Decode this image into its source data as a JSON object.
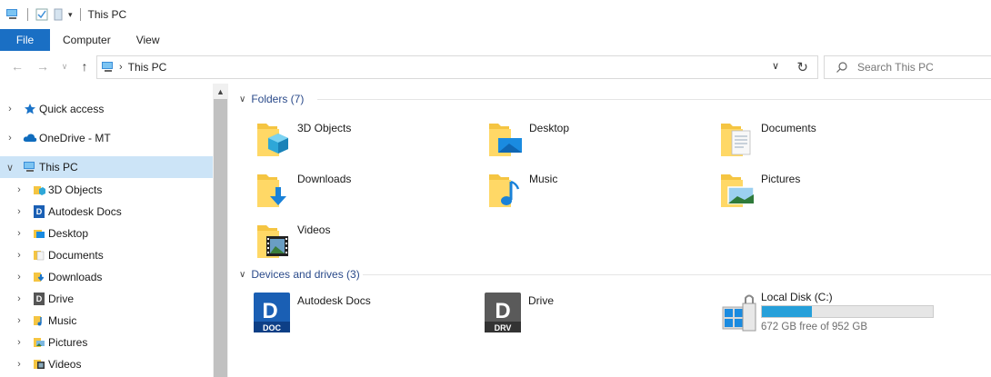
{
  "window": {
    "title": "This PC"
  },
  "ribbon": {
    "tabs": [
      "File",
      "Computer",
      "View"
    ]
  },
  "address": {
    "location": "This PC"
  },
  "search": {
    "placeholder": "Search This PC"
  },
  "sidebar": {
    "items": [
      {
        "label": "Quick access",
        "icon": "star-icon"
      },
      {
        "label": "OneDrive - MT",
        "icon": "cloud-icon"
      },
      {
        "label": "This PC",
        "icon": "computer-icon",
        "expanded": true,
        "selected": true
      },
      {
        "label": "3D Objects",
        "icon": "3d-objects-icon"
      },
      {
        "label": "Autodesk Docs",
        "icon": "autodesk-docs-icon"
      },
      {
        "label": "Desktop",
        "icon": "desktop-folder-icon"
      },
      {
        "label": "Documents",
        "icon": "documents-folder-icon"
      },
      {
        "label": "Downloads",
        "icon": "downloads-folder-icon"
      },
      {
        "label": "Drive",
        "icon": "drive-icon"
      },
      {
        "label": "Music",
        "icon": "music-folder-icon"
      },
      {
        "label": "Pictures",
        "icon": "pictures-folder-icon"
      },
      {
        "label": "Videos",
        "icon": "videos-folder-icon"
      }
    ]
  },
  "folders": {
    "header": "Folders (7)",
    "items": [
      {
        "label": "3D Objects",
        "icon": "3d-objects-folder-icon"
      },
      {
        "label": "Desktop",
        "icon": "desktop-folder-icon"
      },
      {
        "label": "Documents",
        "icon": "documents-folder-icon"
      },
      {
        "label": "Downloads",
        "icon": "downloads-folder-icon"
      },
      {
        "label": "Music",
        "icon": "music-folder-icon"
      },
      {
        "label": "Pictures",
        "icon": "pictures-folder-icon"
      },
      {
        "label": "Videos",
        "icon": "videos-folder-icon"
      }
    ]
  },
  "devices": {
    "header": "Devices and drives (3)",
    "items": [
      {
        "label": "Autodesk Docs",
        "icon": "autodesk-doc-drive-icon",
        "badge": "DOC",
        "letter": "D",
        "color": "#1a5fb4"
      },
      {
        "label": "Drive",
        "icon": "autodesk-drv-drive-icon",
        "badge": "DRV",
        "letter": "D",
        "color": "#555555"
      },
      {
        "label": "Local Disk (C:)",
        "icon": "local-disk-icon",
        "free": "672 GB free of 952 GB",
        "used_fraction": 0.294
      }
    ]
  },
  "colors": {
    "accent": "#1a6fc4",
    "selection": "#cce4f7",
    "drive_fill": "#26a0da",
    "folder": "#f5c542"
  }
}
